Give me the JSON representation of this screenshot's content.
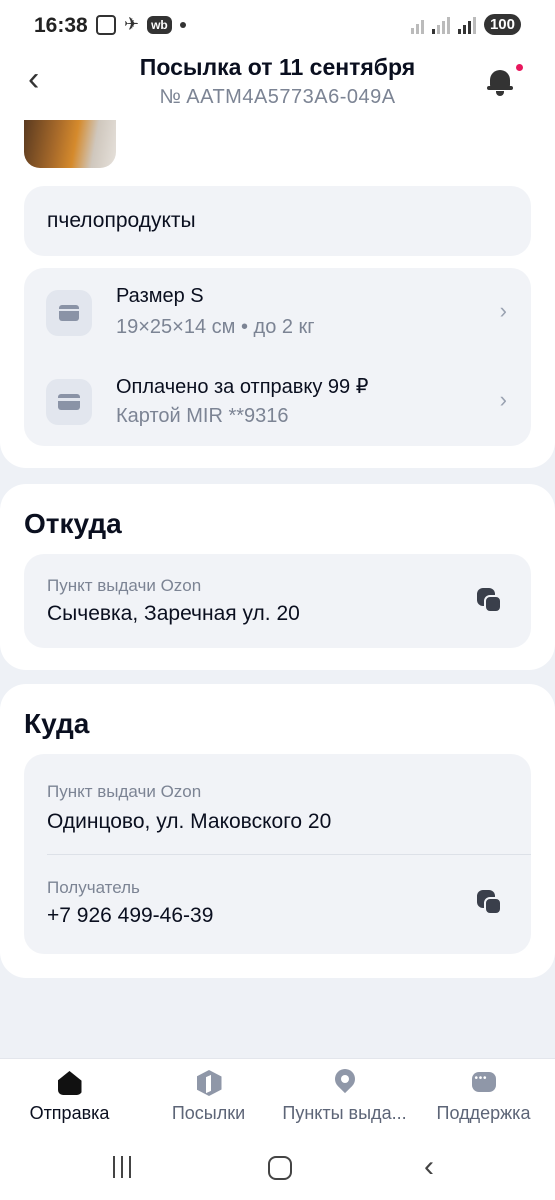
{
  "status_bar": {
    "time": "16:38",
    "battery": "100",
    "wb_badge": "wb"
  },
  "header": {
    "title": "Посылка от 11 сентября",
    "tracking_number": "№ AATM4A5773A6-049A"
  },
  "parcel": {
    "description": "пчелопродукты",
    "size": {
      "title": "Размер S",
      "details": "19×25×14 см • до 2 кг"
    },
    "payment": {
      "title": "Оплачено за отправку 99 ₽",
      "details": "Картой MIR **9316"
    }
  },
  "from": {
    "section_title": "Откуда",
    "pickup_label": "Пункт выдачи Ozon",
    "address": "Сычевка, Заречная ул. 20"
  },
  "to": {
    "section_title": "Куда",
    "pickup_label": "Пункт выдачи Ozon",
    "address": "Одинцово, ул. Маковского 20",
    "recipient_label": "Получатель",
    "recipient_phone": "+7 926 499-46-39"
  },
  "bottom_nav": {
    "tabs": [
      {
        "label": "Отправка",
        "icon": "home-icon",
        "active": true
      },
      {
        "label": "Посылки",
        "icon": "parcel-icon",
        "active": false
      },
      {
        "label": "Пункты выда...",
        "icon": "pin-icon",
        "active": false
      },
      {
        "label": "Поддержка",
        "icon": "chat-icon",
        "active": false
      }
    ]
  },
  "colors": {
    "accent_dot": "#e8175d",
    "muted_text": "#7c8494",
    "card_bg": "#f1f3f7",
    "page_bg": "#eef1f6"
  }
}
